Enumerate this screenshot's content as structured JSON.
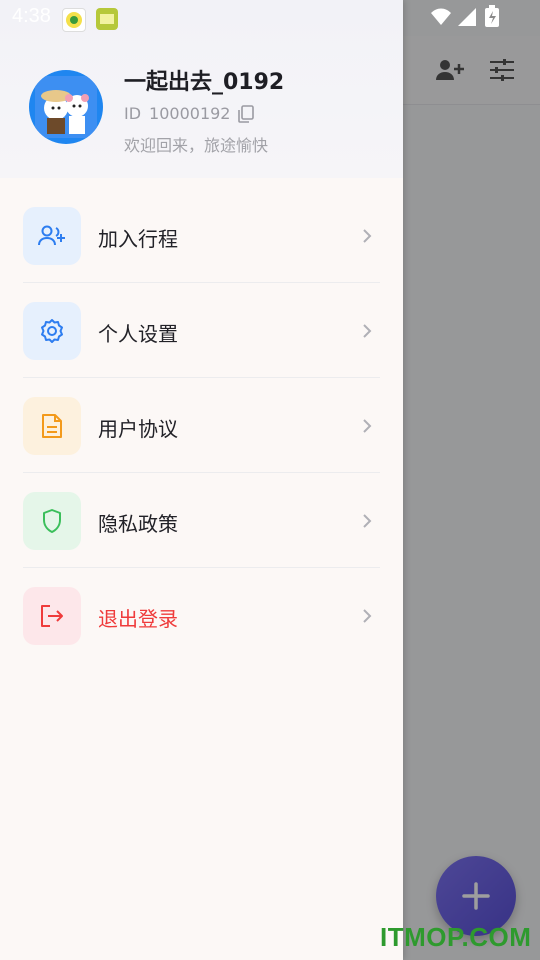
{
  "status_bar": {
    "time": "4:38"
  },
  "profile": {
    "username": "一起出去_0192",
    "id_prefix": "ID",
    "id_value": "10000192",
    "welcome": "欢迎回来，旅途愉快"
  },
  "menu": {
    "items": [
      {
        "label": "加入行程",
        "icon": "add-user-icon",
        "color": "#2d7df0",
        "bg": "#e6f0fd"
      },
      {
        "label": "个人设置",
        "icon": "gear-icon",
        "color": "#2d7df0",
        "bg": "#e6f0fd"
      },
      {
        "label": "用户协议",
        "icon": "document-icon",
        "color": "#f39a1b",
        "bg": "#fdf1de"
      },
      {
        "label": "隐私政策",
        "icon": "shield-icon",
        "color": "#3bbf5b",
        "bg": "#e5f6e9"
      },
      {
        "label": "退出登录",
        "icon": "logout-icon",
        "color": "#ef3b3b",
        "bg": "#fde7ea"
      }
    ]
  },
  "background_app": {
    "toolbar_icons": [
      "add-person-icon",
      "filter-sliders-icon"
    ],
    "fab_icon": "plus-icon"
  },
  "watermark": "ITMOP.COM"
}
